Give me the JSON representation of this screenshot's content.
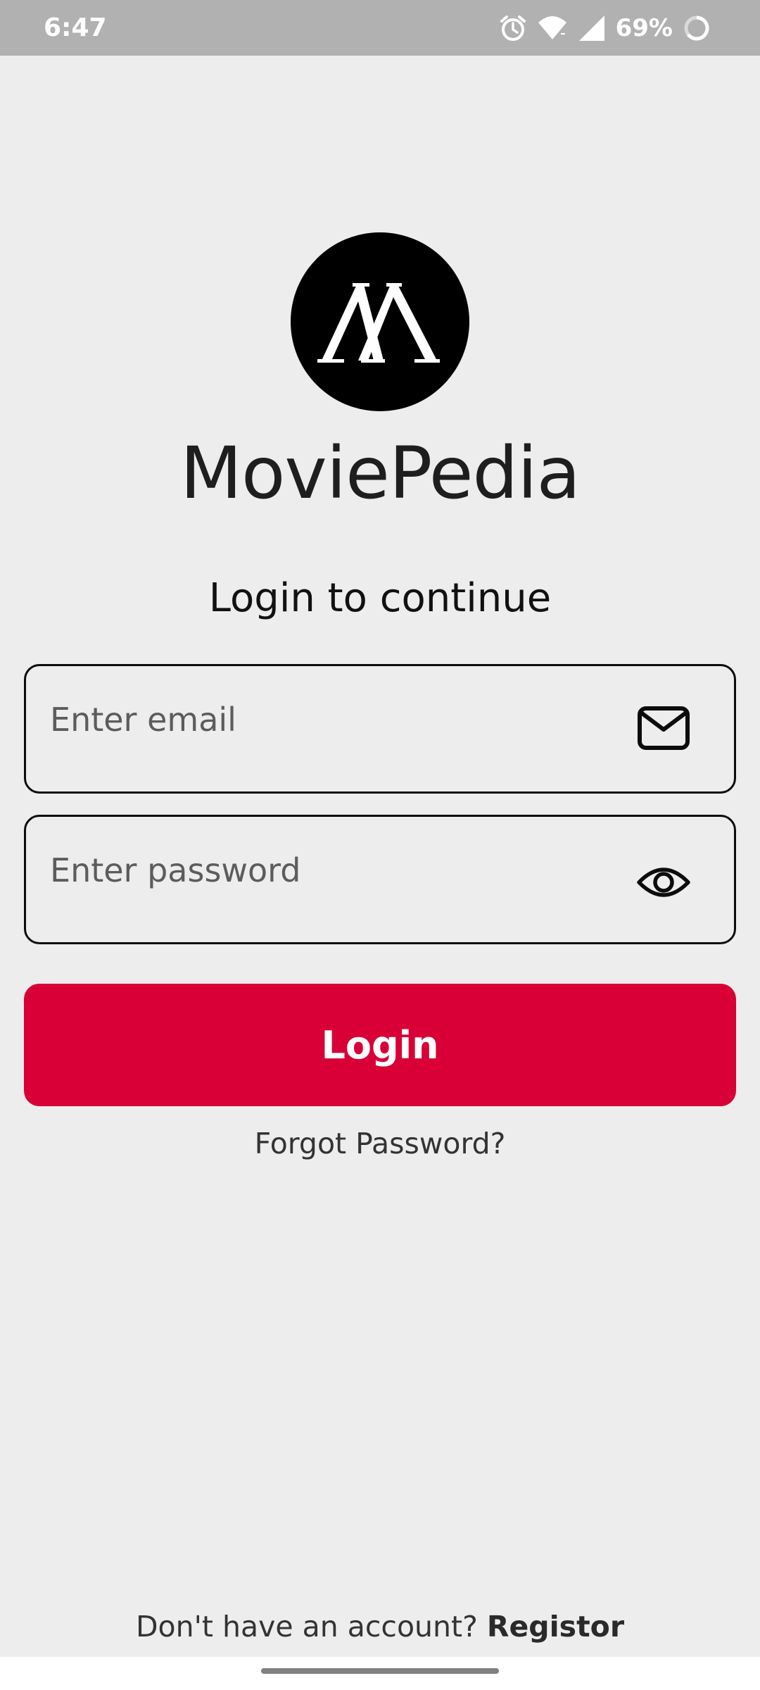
{
  "status_bar": {
    "time": "6:47",
    "battery": "69%",
    "icons": [
      "alarm-icon",
      "wifi-icon",
      "signal-icon",
      "battery-icon"
    ]
  },
  "app": {
    "name": "MoviePedia",
    "logo_icon": "moviepedia-logo"
  },
  "login": {
    "heading": "Login to continue",
    "email_placeholder": "Enter email",
    "email_icon": "mail-icon",
    "password_placeholder": "Enter password",
    "password_icon": "eye-icon",
    "button_label": "Login",
    "forgot_label": "Forgot Password?"
  },
  "register": {
    "prompt": "Don't have an account?",
    "link_label": "Registor"
  },
  "colors": {
    "background": "#ededed",
    "accent": "#d80036",
    "status_bar": "#b1b1b1",
    "text": "#1e1e1e"
  }
}
